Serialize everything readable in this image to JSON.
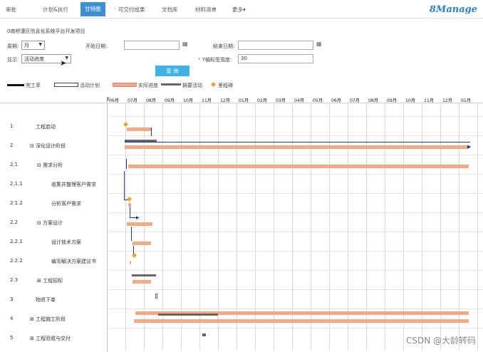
{
  "nav": {
    "tabs": [
      "审批",
      "计划&执行",
      "甘特图",
      "可交付成果",
      "文档库",
      "材料清单",
      "更多"
    ],
    "more_caret": "▾",
    "logo": "8Manage"
  },
  "project_title": "0南桥灌区信息化系统平台开发项目",
  "filters": {
    "period_label": "周期:",
    "period_value": "月",
    "start_label": "开始日期:",
    "end_label": "结束日期:",
    "display_label": "显示:",
    "display_value": "活动进度",
    "y_label": "Y轴标签宽度:",
    "y_required": "*",
    "y_value": "30",
    "query": "查 询"
  },
  "legend": {
    "complete": "完工率",
    "plan": "活动计划",
    "actual": "实际进度",
    "summary": "摘要活动",
    "milestone": "里程碑"
  },
  "months": [
    "06月",
    "07月",
    "08月",
    "09月",
    "10月",
    "11月",
    "12月",
    "01月",
    "02月",
    "03月",
    "04月",
    "05月",
    "06月",
    "07月",
    "08月",
    "09月",
    "10月",
    "11月",
    "12月",
    "01月"
  ],
  "month_prefix": "E",
  "rows": [
    {
      "num": "1",
      "name": "工程启动",
      "expander": ""
    },
    {
      "num": "2",
      "name": "深化设计阶段",
      "expander": "⊟"
    },
    {
      "num": "2.1",
      "name": "需求分析",
      "expander": "⊟"
    },
    {
      "num": "2.1.1",
      "name": "收集并整理客户需求",
      "expander": ""
    },
    {
      "num": "2.1.2",
      "name": "分析客户需求",
      "expander": ""
    },
    {
      "num": "2.2",
      "name": "方案设计",
      "expander": "⊟"
    },
    {
      "num": "2.2.1",
      "name": "设计技术方案",
      "expander": ""
    },
    {
      "num": "2.2.2",
      "name": "编写解决方案建议书",
      "expander": ""
    },
    {
      "num": "2.3",
      "name": "工程招标",
      "expander": "⊞"
    },
    {
      "num": "3",
      "name": "物资下单",
      "expander": ""
    },
    {
      "num": "4",
      "name": "工程施工阶段",
      "expander": "⊞"
    },
    {
      "num": "5",
      "name": "工程验收与交付",
      "expander": "⊞"
    }
  ],
  "colors": {
    "accent": "#3d8fd4",
    "actual": "#f2aa86",
    "summary": "#666666",
    "milestone": "#f0a030",
    "dependency": "#1a3a9a"
  },
  "watermark": "CSDN @大龄转码"
}
